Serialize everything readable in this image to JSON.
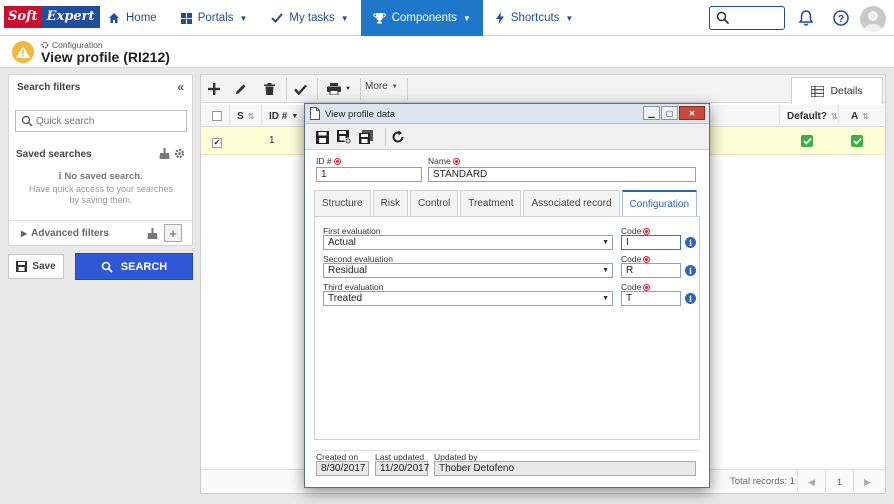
{
  "brand": {
    "part1": "Soft",
    "part2": "Expert"
  },
  "nav": [
    {
      "label": "Home",
      "icon": "home-icon",
      "active": false
    },
    {
      "label": "Portals",
      "icon": "grid-icon",
      "active": false,
      "caret": true
    },
    {
      "label": "My tasks",
      "icon": "check-icon",
      "active": false,
      "caret": true
    },
    {
      "label": "Components",
      "icon": "trophy-icon",
      "active": true,
      "caret": true
    },
    {
      "label": "Shortcuts",
      "icon": "bolt-icon",
      "active": false,
      "caret": true
    }
  ],
  "header": {
    "breadcrumb": "Configuration",
    "title": "View profile (RI212)"
  },
  "filters": {
    "title": "Search filters",
    "quick_search_placeholder": "Quick search",
    "saved_searches_title": "Saved searches",
    "no_saved": "No saved search.",
    "no_saved_hint": "Have quick access to your searches by saving them.",
    "advanced_filters": "Advanced filters",
    "save_label": "Save",
    "search_label": "SEARCH"
  },
  "toolbar": {
    "more_label": "More",
    "details_label": "Details"
  },
  "grid": {
    "columns": {
      "s": "S",
      "id": "ID #",
      "default": "Default?",
      "a": "A"
    },
    "rows": [
      {
        "id": "1",
        "default": true,
        "a": true
      }
    ],
    "total_records": "Total records: 1",
    "page": "1"
  },
  "modal": {
    "title": "View profile data",
    "id_label": "ID #",
    "id_value": "1",
    "name_label": "Name",
    "name_value": "STANDARD",
    "tabs": [
      "Structure",
      "Risk",
      "Control",
      "Treatment",
      "Associated record",
      "Configuration"
    ],
    "active_tab": "Configuration",
    "first_eval_label": "First evaluation",
    "first_eval_value": "Actual",
    "second_eval_label": "Second evaluation",
    "second_eval_value": "Residual",
    "third_eval_label": "Third evaluation",
    "third_eval_value": "Treated",
    "code_label": "Code",
    "code1": "I",
    "code2": "R",
    "code3": "T",
    "created_on_label": "Created on",
    "created_on": "8/30/2017",
    "last_updated_label": "Last updated",
    "last_updated": "11/20/2017",
    "updated_by_label": "Updated by",
    "updated_by": "Thober Detofeno"
  },
  "colors": {
    "accent": "#1f77c9",
    "search_button": "#2f58d6",
    "selected_row": "#fdfdd6",
    "check_green": "#3cb043"
  }
}
